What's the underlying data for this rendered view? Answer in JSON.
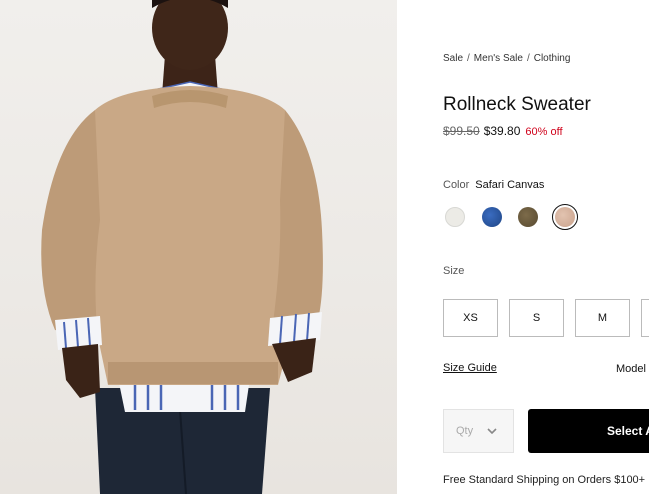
{
  "breadcrumb": {
    "items": [
      "Sale",
      "Men's Sale",
      "Clothing"
    ],
    "separator": "/"
  },
  "product": {
    "title": "Rollneck Sweater",
    "original_price": "$99.50",
    "sale_price": "$39.80",
    "discount": "60% off"
  },
  "color": {
    "label": "Color",
    "selected": "Safari Canvas",
    "swatches": [
      {
        "color": "#ecebe6",
        "selected": false
      },
      {
        "color": "#2c5aa0",
        "selected": false
      },
      {
        "color": "#6e5d3e",
        "selected": false
      },
      {
        "color": "#d9b8a4",
        "selected": true
      }
    ]
  },
  "size": {
    "label": "Size",
    "options": [
      "XS",
      "S",
      "M",
      ""
    ]
  },
  "size_guide": "Size Guide",
  "model_info": "Model",
  "quantity": {
    "placeholder": "Qty"
  },
  "select_button": "Select A",
  "shipping": "Free Standard Shipping on Orders $100+"
}
